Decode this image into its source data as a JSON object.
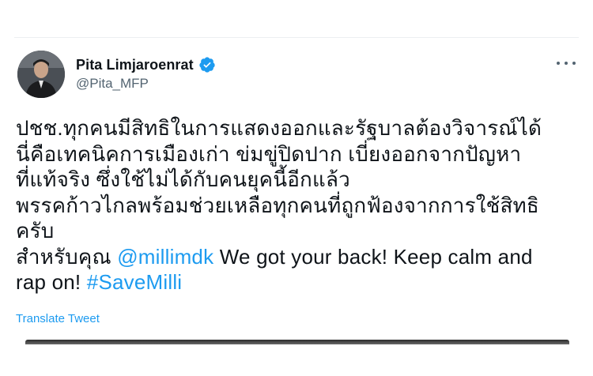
{
  "author": {
    "display_name": "Pita Limjaroenrat",
    "handle": "@Pita_MFP",
    "verified": true
  },
  "tweet": {
    "lines": [
      "ปชช.ทุกคนมีสิทธิในการแสดงออกและรัฐบาลต้องวิจารณ์ได้",
      "นี่คือเทคนิคการเมืองเก่า ข่มขู่ปิดปาก เบี่ยงออกจากปัญหา",
      "ที่แท้จริง ซึ่งใช้ไม่ได้กับคนยุคนี้อีกแล้ว",
      "พรรคก้าวไกลพร้อมช่วยเหลือทุกคนที่ถูกฟ้องจากการใช้สิทธิ",
      "ครับ"
    ],
    "line6_prefix": "สำหรับคุณ ",
    "mention": "@millimdk",
    "line6_suffix": " We got your back! Keep calm and",
    "line7_prefix": "rap on! ",
    "hashtag": "#SaveMilli",
    "translate_label": "Translate Tweet"
  },
  "colors": {
    "text": "#0f1419",
    "secondary": "#536471",
    "accent": "#1d9bf0"
  },
  "icons": {
    "verified": "verified-badge-icon",
    "more": "more-options-icon"
  }
}
